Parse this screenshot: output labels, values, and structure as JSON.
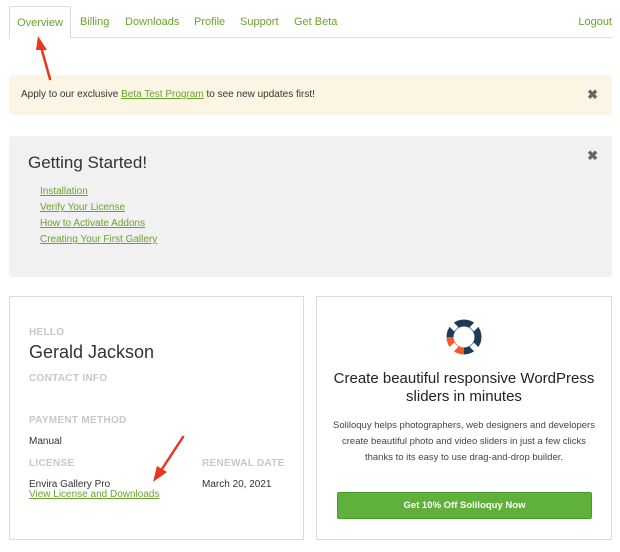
{
  "tabs": {
    "items": [
      {
        "label": "Overview",
        "active": true
      },
      {
        "label": "Billing"
      },
      {
        "label": "Downloads"
      },
      {
        "label": "Profile"
      },
      {
        "label": "Support"
      },
      {
        "label": "Get Beta"
      }
    ],
    "logout": "Logout"
  },
  "beta_notice": {
    "text_before": "Apply to our exclusive ",
    "link": "Beta Test Program",
    "text_after": " to see new updates first!",
    "close": "✖"
  },
  "getting_started": {
    "title": "Getting Started!",
    "close": "✖",
    "links": [
      "Installation",
      "Verify Your License",
      "How to Activate Addons",
      "Creating Your First Gallery"
    ]
  },
  "account": {
    "hello_label": "HELLO",
    "name": "Gerald Jackson",
    "contact_label": "CONTACT INFO",
    "payment_label": "PAYMENT METHOD",
    "payment_value": "Manual",
    "license_label": "LICENSE",
    "license_value": "Envira Gallery Pro",
    "renewal_label": "RENEWAL DATE",
    "renewal_value": "March 20, 2021",
    "license_link": "View License and Downloads"
  },
  "promo": {
    "logo_icon": "soliloquy-logo-icon",
    "title": "Create beautiful responsive WordPress sliders in minutes",
    "description": "Soliloquy helps photographers, web designers and developers create beautiful photo and video sliders in just a few clicks thanks to its easy to use drag-and-drop builder.",
    "button": "Get 10% Off Soliloquy Now"
  },
  "colors": {
    "link_green": "#6aa32b",
    "button_green": "#5fb13b",
    "notice_bg": "#fbf6e4",
    "panel_bg": "#f1f1f1",
    "arrow_red": "#e8361f",
    "logo_dark": "#1d3b57",
    "logo_orange": "#f15a24"
  }
}
